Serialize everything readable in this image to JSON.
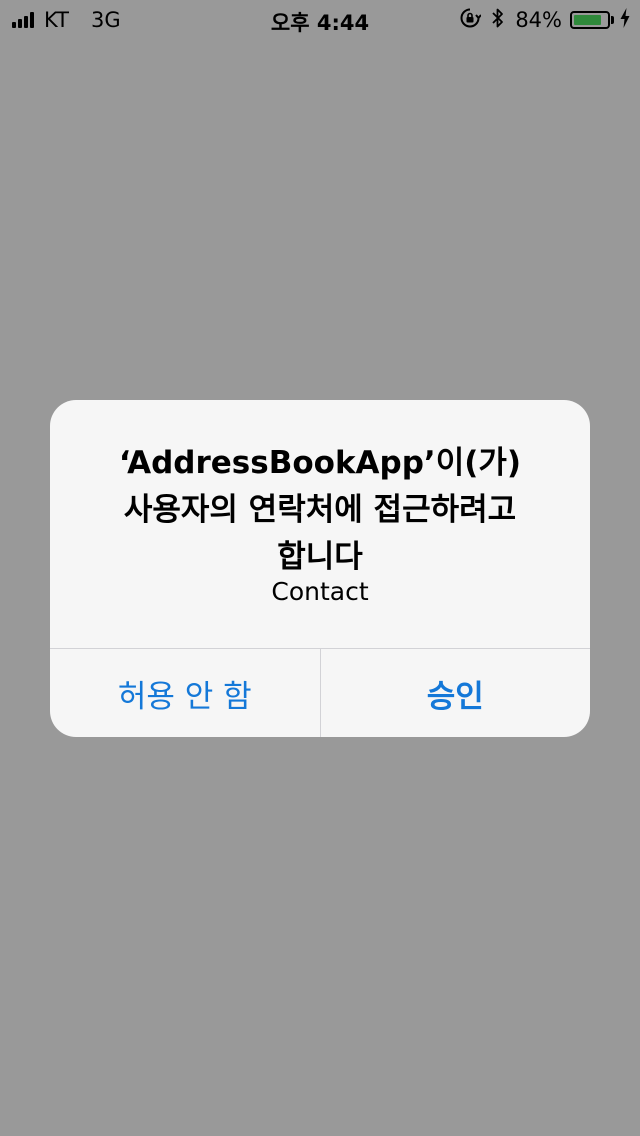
{
  "status_bar": {
    "carrier": "KT",
    "network": "3G",
    "time": "오후 4:44",
    "battery_percent_text": "84%",
    "battery_level": 0.84,
    "icons": [
      "signal-icon",
      "rotation-lock-icon",
      "bluetooth-icon",
      "battery-icon",
      "charging-icon"
    ]
  },
  "alert": {
    "title_line1": "‘AddressBookApp’이(가)",
    "title_line2": "사용자의 연락처에 접근하려고",
    "title_line3": "합니다",
    "message": "Contact",
    "deny_label": "허용 안 함",
    "allow_label": "승인"
  },
  "colors": {
    "dim_background": "#999999",
    "alert_background": "#f6f6f6",
    "button_text": "#1478d8",
    "battery_fill": "#2f8a3b"
  }
}
